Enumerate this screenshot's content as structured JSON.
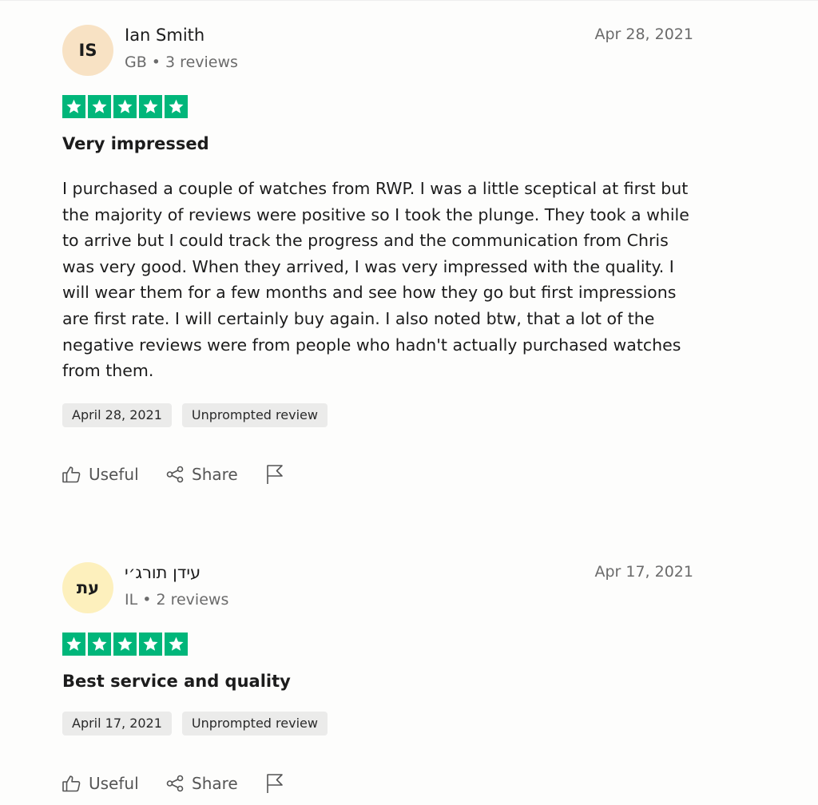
{
  "colors": {
    "star_bg": "#00b67a",
    "avatar_1": "#f8e2c4",
    "avatar_2": "#fdf0bd"
  },
  "reviews": [
    {
      "initials": "IS",
      "name": "Ian Smith",
      "meta": "GB • 3 reviews",
      "date": "Apr 28, 2021",
      "rating": 5,
      "title": "Very impressed",
      "body": "I purchased a couple of watches from RWP. I was a little sceptical at first but the majority of reviews were positive so I took the plunge. They took a while to arrive but I could track the progress and the communication from Chris was very good. When they arrived, I was very impressed with the quality. I will wear them for a few months and see how they go but first impressions are first rate. I will certainly buy again. I also noted btw, that a lot of the negative reviews were from people who hadn't actually purchased watches from them.",
      "tags": [
        "April 28, 2021",
        "Unprompted review"
      ],
      "actions": {
        "useful": "Useful",
        "share": "Share"
      }
    },
    {
      "initials": "עת",
      "name": "עידן תורג׳י",
      "meta": "IL • 2 reviews",
      "date": "Apr 17, 2021",
      "rating": 5,
      "title": "Best service and quality",
      "body": "",
      "tags": [
        "April 17, 2021",
        "Unprompted review"
      ],
      "actions": {
        "useful": "Useful",
        "share": "Share"
      }
    }
  ]
}
